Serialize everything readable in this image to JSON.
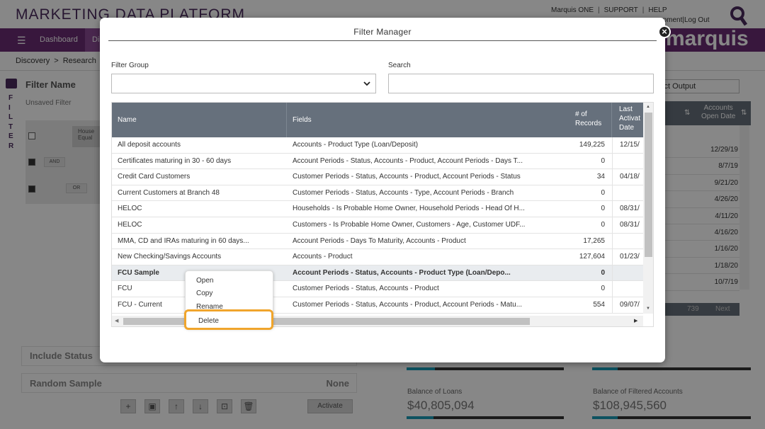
{
  "app": {
    "title": "MARKETING DATA PLATFORM",
    "top_links": [
      "Marquis ONE",
      "SUPPORT",
      "HELP"
    ],
    "top_links2": [
      "opment",
      "Log Out"
    ],
    "logo": "marquis"
  },
  "nav": {
    "dashboard": "Dashboard",
    "active_tab": "Di"
  },
  "breadcrumbs": [
    "Discovery",
    "Research"
  ],
  "filter_panel": {
    "side_label": "FILTER",
    "filter_name": "Filter Name",
    "unsaved": "Unsaved Filter",
    "chip_text": "House Equal",
    "and_label": "AND",
    "or_label": "OR",
    "include_status": "Include Status",
    "random_sample_label": "Random Sample",
    "random_sample_value": "None",
    "activate": "Activate"
  },
  "right_table": {
    "select_output": "lect Output",
    "header_accounts": "Accounts",
    "header_open_date": "Open Date",
    "dates": [
      "12/29/19",
      "8/7/19",
      "9/21/20",
      "4/26/20",
      "4/11/20",
      "4/16/20",
      "1/16/20",
      "1/18/20",
      "10/7/19"
    ],
    "partial_text": "ate",
    "pager_count": "739",
    "pager_next": "Next"
  },
  "stats": [
    {
      "label": "Balance of Loans",
      "value": "$40,805,094"
    },
    {
      "label": "Balance of Filtered Accounts",
      "value": "$108,945,560"
    }
  ],
  "modal": {
    "title": "Filter Manager",
    "close_label": "×",
    "filter_group_label": "Filter Group",
    "filter_group_value": "",
    "search_label": "Search",
    "search_value": "",
    "columns": {
      "name": "Name",
      "fields": "Fields",
      "records": "# of Records",
      "last": "Last Activat Date"
    },
    "rows": [
      {
        "name": "All deposit accounts",
        "fields": "Accounts - Product Type (Loan/Deposit)",
        "records": "149,225",
        "last": "12/15/"
      },
      {
        "name": "Certificates maturing in 30 - 60 days",
        "fields": "Account Periods - Status, Accounts - Product, Account Periods - Days T...",
        "records": "0",
        "last": ""
      },
      {
        "name": "Credit Card Customers",
        "fields": "Customer Periods - Status, Accounts - Product, Account Periods - Status",
        "records": "34",
        "last": "04/18/"
      },
      {
        "name": "Current Customers at Branch 48",
        "fields": "Customer Periods - Status, Accounts - Type, Account Periods - Branch",
        "records": "0",
        "last": ""
      },
      {
        "name": "HELOC",
        "fields": "Households - Is Probable Home Owner, Household Periods - Head Of H...",
        "records": "0",
        "last": "08/31/"
      },
      {
        "name": "HELOC",
        "fields": "Customers - Is Probable Home Owner, Customers - Age, Customer UDF...",
        "records": "0",
        "last": "08/31/"
      },
      {
        "name": "MMA, CD and IRAs maturing in 60 days...",
        "fields": "Account Periods - Days To Maturity, Accounts - Product",
        "records": "17,265",
        "last": ""
      },
      {
        "name": "New Checking/Savings Accounts",
        "fields": "Accounts - Product",
        "records": "127,604",
        "last": "01/23/"
      },
      {
        "name": "FCU Sample",
        "fields": "Account Periods - Status, Accounts - Product Type (Loan/Depo...",
        "records": "0",
        "last": ""
      },
      {
        "name": "FCU",
        "fields": "Customer Periods - Status, Accounts - Product",
        "records": "0",
        "last": ""
      },
      {
        "name": "FCU - Current",
        "fields": "Customer Periods - Status, Accounts - Product, Account Periods - Matu...",
        "records": "554",
        "last": "09/07/"
      }
    ]
  },
  "context_menu": {
    "items": [
      "Open",
      "Copy",
      "Rename",
      "Delete"
    ]
  }
}
